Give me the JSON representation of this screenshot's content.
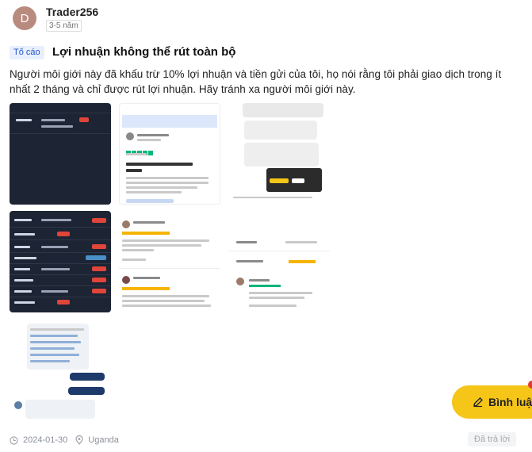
{
  "user": {
    "avatar_letter": "D",
    "name": "Trader256",
    "experience": "3-5 năm"
  },
  "review": {
    "tag": "Tố cáo",
    "title": "Lợi nhuận không thể rút toàn bộ",
    "body": "Người môi giới này đã khấu trừ 10% lợi nhuận và tiền gửi của tôi, họ nói rằng tôi phải giao dịch trong ít nhất 2 tháng và chỉ được rút lợi nhuận. Hãy tránh xa người môi giới này."
  },
  "footer": {
    "date": "2024-01-30",
    "location": "Uganda",
    "replied_label": "Đã trả lời"
  },
  "fab": {
    "label": "Bình luận"
  },
  "colors": {
    "accent_yellow": "#f5c518",
    "tag_blue": "#2458c8",
    "trustpilot_green": "#00b67a"
  },
  "icons": {
    "clock": "clock-icon",
    "location": "location-pin-icon",
    "pencil": "pencil-icon"
  }
}
